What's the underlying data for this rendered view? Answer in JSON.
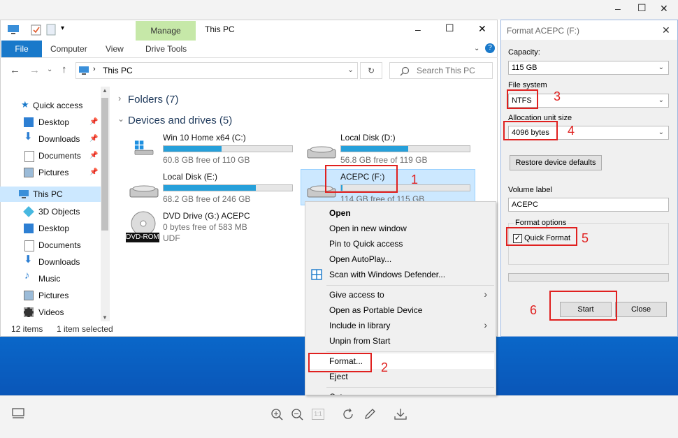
{
  "viewer": {
    "controls": {
      "minimize": "–",
      "maximize": "☐",
      "close": "✕"
    },
    "bottom_tools": [
      "monitor-icon",
      "zoom-in-icon",
      "zoom-out-icon",
      "actual-size-icon",
      "rotate-icon",
      "edit-icon",
      "download-icon"
    ],
    "actual_size_label": "1:1"
  },
  "explorer": {
    "title": "This PC",
    "manage_tab": "Manage",
    "tabs": {
      "file": "File",
      "computer": "Computer",
      "view": "View",
      "drive_tools": "Drive Tools"
    },
    "address": "This PC",
    "search_placeholder": "Search This PC",
    "sections": {
      "folders": "Folders (7)",
      "devices": "Devices and drives (5)"
    },
    "nav": {
      "quick_access": "Quick access",
      "qa_items": [
        "Desktop",
        "Downloads",
        "Documents",
        "Pictures"
      ],
      "this_pc": "This PC",
      "pc_items": [
        "3D Objects",
        "Desktop",
        "Documents",
        "Downloads",
        "Music",
        "Pictures",
        "Videos"
      ]
    },
    "drives": [
      {
        "name": "Win 10 Home x64 (C:)",
        "free": "60.8 GB free of 110 GB",
        "used": 0.45
      },
      {
        "name": "Local Disk (D:)",
        "free": "56.8 GB free of 119 GB",
        "used": 0.52
      },
      {
        "name": "Local Disk (E:)",
        "free": "68.2 GB free of 246 GB",
        "used": 0.72
      },
      {
        "name": "ACEPC (F:)",
        "free": "114 GB free of 115 GB",
        "used": 0.01
      }
    ],
    "dvd": {
      "name": "DVD Drive (G:) ACEPC",
      "free": "0 bytes free of 583 MB",
      "fs": "UDF",
      "badge": "DVD-ROM"
    },
    "status": {
      "items": "12 items",
      "selected": "1 item selected"
    }
  },
  "context_menu": {
    "items": [
      "Open",
      "Open in new window",
      "Pin to Quick access",
      "Open AutoPlay...",
      "Scan with Windows Defender...",
      "Give access to",
      "Open as Portable Device",
      "Include in library",
      "Unpin from Start",
      "Format...",
      "Eject",
      "Cut"
    ]
  },
  "format_dialog": {
    "title": "Format ACEPC (F:)",
    "capacity_label": "Capacity:",
    "capacity_value": "115 GB",
    "fs_label": "File system",
    "fs_value": "NTFS",
    "alloc_label": "Allocation unit size",
    "alloc_value": "4096 bytes",
    "restore_button": "Restore device defaults",
    "volume_label": "Volume label",
    "volume_value": "ACEPC",
    "options_label": "Format options",
    "quick_format": "Quick Format",
    "start_button": "Start",
    "close_button": "Close"
  },
  "annotations": [
    "1",
    "2",
    "3",
    "4",
    "5",
    "6"
  ],
  "colors": {
    "accent": "#1979ca",
    "annotation": "#e0201f",
    "progress": "#26a0da",
    "manage": "#c6e8a8"
  }
}
